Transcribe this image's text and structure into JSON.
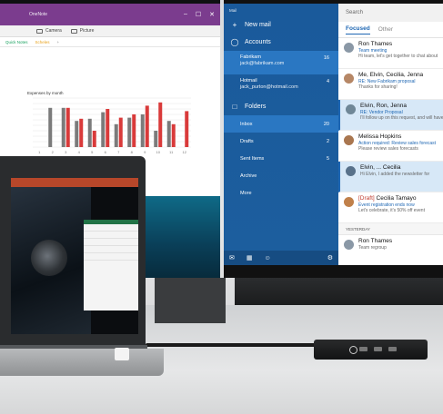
{
  "onenote": {
    "title": "OneNote",
    "window_controls": [
      "–",
      "☐",
      "✕"
    ],
    "ribbon": {
      "camera_label": "Camera",
      "picture_label": "Picture"
    },
    "tabs": [
      "Quick Notes",
      "Scheles",
      "+"
    ],
    "chart_title": "Expenses by month"
  },
  "chart_data": {
    "type": "bar",
    "title": "Expenses by month",
    "xlabel": "",
    "ylabel": "",
    "categories": [
      "1",
      "2",
      "3",
      "4",
      "5",
      "6",
      "7",
      "8",
      "9",
      "10",
      "11",
      "12"
    ],
    "series": [
      {
        "values": [
          0,
          3.6,
          3.6,
          2.4,
          2.6,
          3.2,
          2.1,
          2.7,
          3.0,
          1.5,
          2.4,
          0
        ]
      },
      {
        "values": [
          0,
          0,
          3.6,
          2.6,
          1.5,
          3.5,
          2.7,
          3.0,
          3.8,
          4.1,
          2.1,
          3.3
        ]
      }
    ],
    "colors": [
      "#7b7b7b",
      "#d93a3a"
    ],
    "ylim": [
      0,
      4.5
    ],
    "grid": true
  },
  "mail": {
    "app_title": "Mail",
    "new_mail": "New mail",
    "accounts_label": "Accounts",
    "accounts": [
      {
        "name": "Fabrikam",
        "email": "jack@fabrikam.com",
        "count": "16"
      },
      {
        "name": "Hotmail",
        "email": "jack_purton@hotmail.com",
        "count": "4"
      }
    ],
    "folders_label": "Folders",
    "folders": [
      {
        "name": "Inbox",
        "count": "20"
      },
      {
        "name": "Drafts",
        "count": "2"
      },
      {
        "name": "Sent Items",
        "count": "5"
      },
      {
        "name": "Archive",
        "count": ""
      },
      {
        "name": "More",
        "count": ""
      }
    ],
    "search_placeholder": "Search",
    "tab_focused": "Focused",
    "tab_other": "Other",
    "messages": [
      {
        "sender": "Ron Thames",
        "draft": "",
        "subject": "Team meeting",
        "preview": "Hi team, let's get together to chat about"
      },
      {
        "sender": "Me, Elvin, Cecilia, Jenna",
        "draft": "",
        "subject": "RE: New Fabrikam proposal",
        "preview": "Thanks for sharing!"
      },
      {
        "sender": "Elvin, Ron, Jenna",
        "draft": "",
        "subject": "RE: Vendor Proposal",
        "preview": "I'll follow up on this request, and will have"
      },
      {
        "sender": "Melissa Hopkins",
        "draft": "",
        "subject": "Action required: Review sales forecast",
        "preview": "Please review sales forecasts"
      },
      {
        "sender": "Elvin, ... Cecilia",
        "draft": "",
        "subject": "",
        "preview": "Hi Elvin, I added the newsletter for"
      },
      {
        "sender": "Cecilia Tamayo",
        "draft": "[Draft]",
        "subject": "Event registration ends now",
        "preview": "Let's celebrate, it's 50% off event"
      }
    ],
    "day_header": "YESTERDAY",
    "yesterday_message": {
      "sender": "Ron Thames",
      "preview": "Team regroup"
    }
  }
}
